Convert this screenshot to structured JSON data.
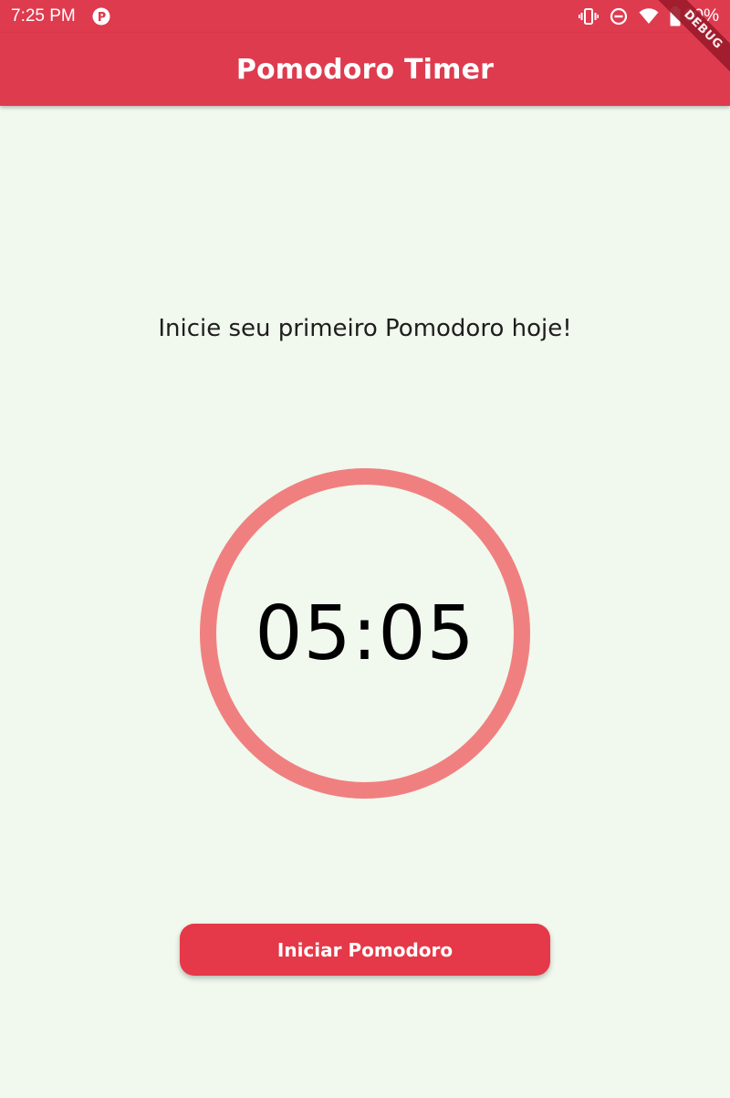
{
  "status_bar": {
    "time": "7:25 PM",
    "battery_percent": "90%",
    "icons": [
      "app-notification-icon",
      "vibrate-icon",
      "do-not-disturb-icon",
      "wifi-icon",
      "battery-icon"
    ]
  },
  "app_bar": {
    "title": "Pomodoro Timer",
    "debug_label": "DEBUG",
    "color": "#de3b4f"
  },
  "main": {
    "subtitle": "Inicie seu primeiro Pomodoro hoje!",
    "timer": {
      "display": "05:05",
      "progress": 1.0,
      "ring_color": "#f08080"
    },
    "start_button": {
      "label": "Iniciar Pomodoro",
      "color": "#e53848"
    }
  },
  "colors": {
    "background": "#f1f8ee",
    "accent": "#de3b4f"
  }
}
